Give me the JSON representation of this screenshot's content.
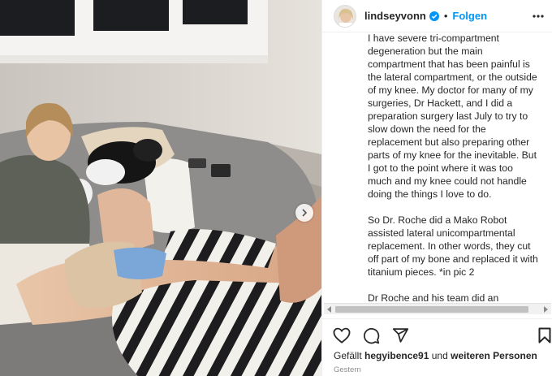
{
  "post": {
    "username": "lindseyvonn",
    "separator": "•",
    "follow_label": "Folgen",
    "caption_paragraphs": [
      "I have severe tri-compartment degeneration but the main compartment that has been painful is the lateral compartment, or the outside of my knee. My doctor for many of my surgeries, Dr Hackett, and I did a preparation surgery last July to try to slow down the need for the replacement but also preparing other parts of my knee for the inevitable. But I got to the point where it was too much and my knee could not handle doing the things I love to do.",
      "So Dr. Roche did a Mako Robot assisted lateral unicompartmental replacement. In other words, they cut off part of my bone and replaced it with titanium pieces. *in pic 2",
      "Dr Roche and his team did an"
    ],
    "likes": {
      "prefix": "Gefällt",
      "user": "hegyibence91",
      "middle": "und",
      "others": "weiteren Personen"
    },
    "date": "Gestern"
  },
  "icons": {
    "verified": "verified-badge-icon",
    "more": "more-options-icon",
    "like": "heart-icon",
    "comment": "comment-icon",
    "share": "share-icon",
    "save": "bookmark-icon",
    "next": "chevron-right-icon"
  },
  "colors": {
    "accent": "#0095f6",
    "text": "#262626",
    "muted": "#8e8e8e"
  }
}
